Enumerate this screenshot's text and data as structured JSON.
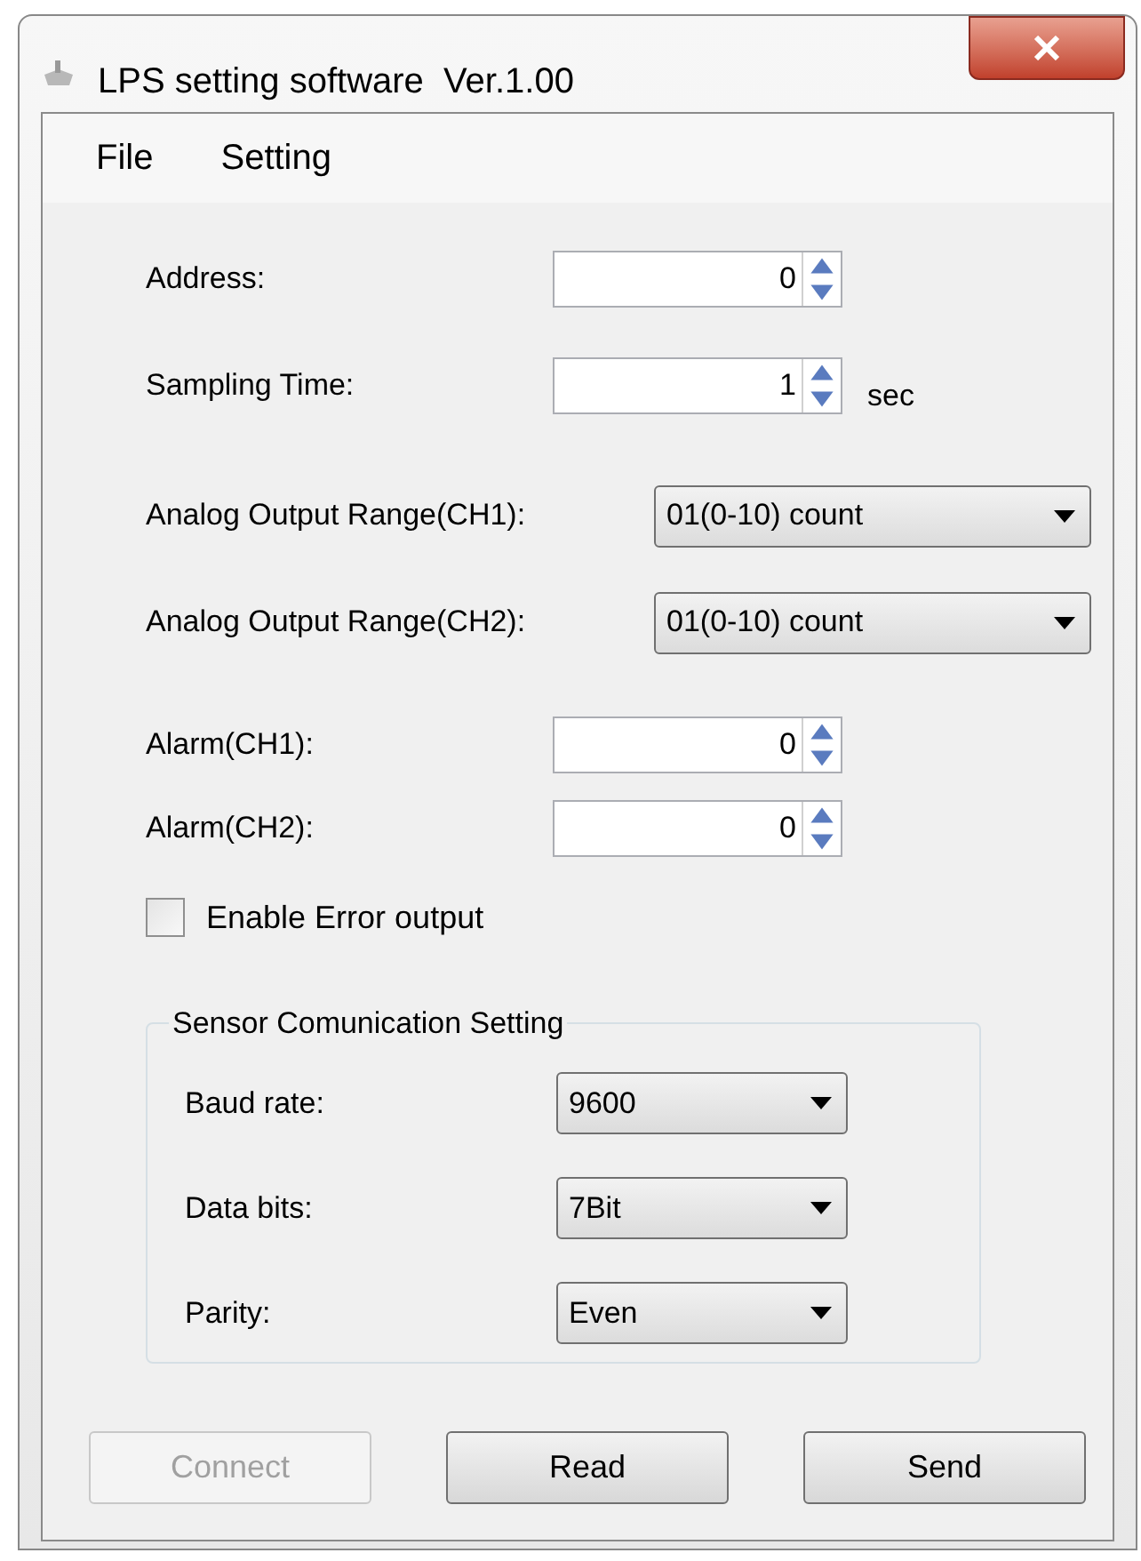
{
  "window": {
    "title": "LPS setting software  Ver.1.00"
  },
  "menu": [
    {
      "label": "File"
    },
    {
      "label": "Setting"
    }
  ],
  "fields": [
    {
      "kind": "spinbox",
      "label": "Address:",
      "value": "0"
    },
    {
      "kind": "spinbox",
      "label": "Sampling Time:",
      "value": "1",
      "unit": "sec"
    },
    {
      "kind": "select",
      "label": "Analog Output Range(CH1):",
      "value": "01(0-10) count"
    },
    {
      "kind": "select",
      "label": "Analog Output Range(CH2):",
      "value": "01(0-10) count"
    },
    {
      "kind": "spinbox",
      "label": "Alarm(CH1):",
      "value": "0"
    },
    {
      "kind": "spinbox",
      "label": "Alarm(CH2):",
      "value": "0"
    }
  ],
  "error_output": {
    "label": "Enable Error output",
    "checked": false
  },
  "sensor_group": {
    "title": "Sensor Comunication Setting",
    "fields": [
      {
        "label": "Baud rate:",
        "value": "9600"
      },
      {
        "label": "Data bits:",
        "value": "7Bit"
      },
      {
        "label": "Parity:",
        "value": "Even"
      }
    ]
  },
  "buttons": [
    {
      "label": "Connect",
      "disabled": true
    },
    {
      "label": "Read",
      "disabled": false
    },
    {
      "label": "Send",
      "disabled": false
    }
  ]
}
